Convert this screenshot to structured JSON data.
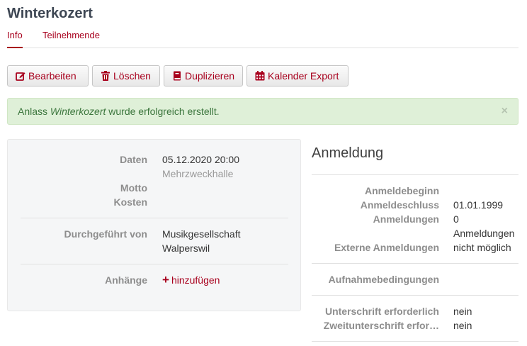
{
  "page": {
    "title": "Winterkozert"
  },
  "tabs": [
    "Info",
    "Teilnehmende"
  ],
  "toolbar": {
    "edit_label": "Bearbeiten",
    "delete_label": "Löschen",
    "duplicate_label": "Duplizieren",
    "export_label": "Kalender Export"
  },
  "alert": {
    "prefix": "Anlass ",
    "name": "Winterkozert",
    "suffix": " wurde erfolgreich erstellt.",
    "close": "×"
  },
  "details": {
    "dates_label": "Daten",
    "dates_value": "05.12.2020 20:00",
    "location": "Mehrzweckhalle",
    "motto_label": "Motto",
    "costs_label": "Kosten",
    "organizer_label": "Durchgeführt von",
    "organizer_line1": "Musikgesellschaft",
    "organizer_line2": "Walperswil",
    "attachments_label": "Anhänge",
    "add_label": "hinzufügen"
  },
  "registration": {
    "title": "Anmeldung",
    "start_label": "Anmeldebeginn",
    "end_label": "Anmeldeschluss",
    "end_value": "01.01.1999",
    "count_label": "Anmeldungen",
    "count_value": "0",
    "external_label": "Externe Anmeldungen",
    "external_value_line1": "Anmeldungen",
    "external_value_line2": "nicht möglich",
    "conditions_label": "Aufnahmebedingungen",
    "signature_label": "Unterschrift erforderlich",
    "signature_value": "nein",
    "second_signature_label": "Zweitunterschrift erfor…",
    "second_signature_value": "nein"
  },
  "icons": {
    "edit": "pencil-square-icon",
    "delete": "trash-icon",
    "duplicate": "book-icon",
    "export": "calendar-icon",
    "add": "plus-icon",
    "close": "close-icon"
  },
  "colors": {
    "accent": "#a8001d",
    "success_bg": "#dff0d8",
    "success_text": "#3c763d"
  }
}
